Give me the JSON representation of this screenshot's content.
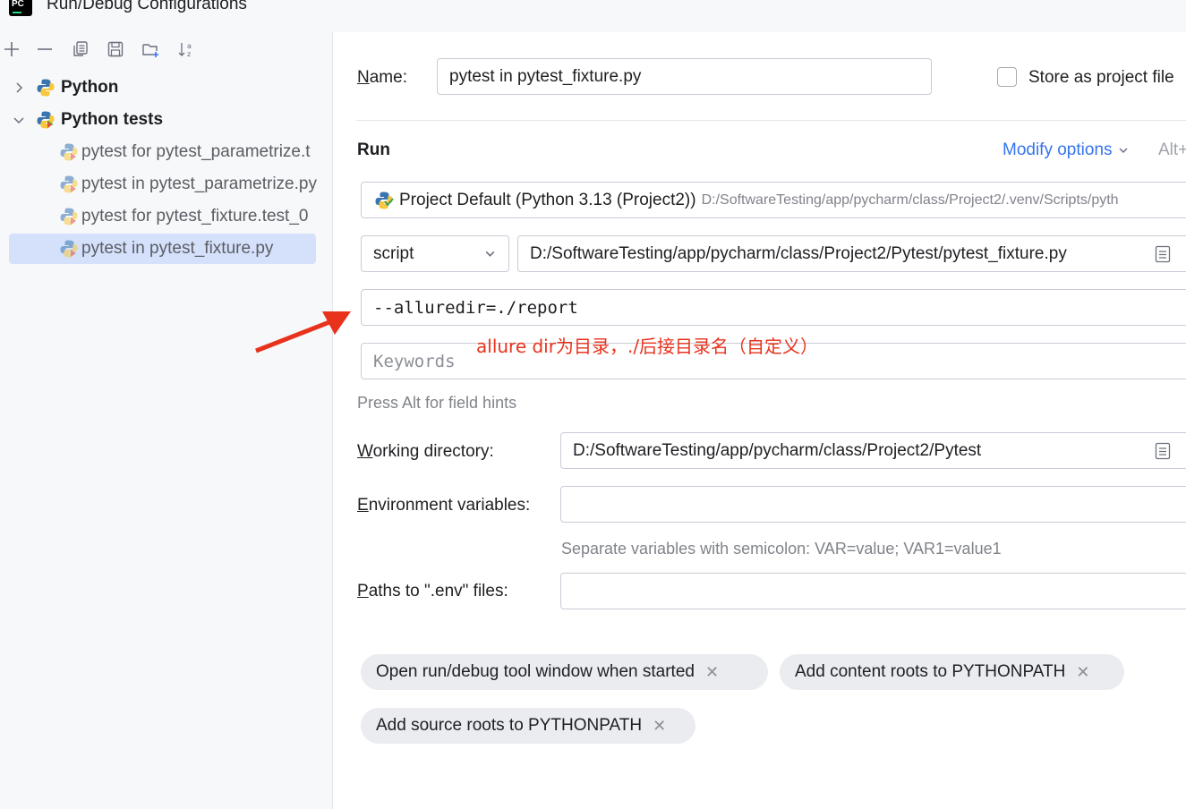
{
  "window": {
    "title": "Run/Debug Configurations",
    "app_icon_text": "PC"
  },
  "toolbar": {
    "icons": [
      "add-icon",
      "remove-icon",
      "copy-icon",
      "save-icon",
      "new-folder-icon",
      "sort-icon"
    ]
  },
  "tree": {
    "groups": [
      {
        "label": "Python",
        "expanded": false
      },
      {
        "label": "Python tests",
        "expanded": true
      }
    ],
    "items": [
      {
        "label": "pytest for pytest_parametrize.t"
      },
      {
        "label": "pytest in pytest_parametrize.py"
      },
      {
        "label": "pytest for pytest_fixture.test_0"
      },
      {
        "label": "pytest in pytest_fixture.py",
        "selected": true
      }
    ]
  },
  "form": {
    "name_label_u": "N",
    "name_label_rest": "ame:",
    "name_value": "pytest in pytest_fixture.py",
    "store_label": "Store as project file",
    "run_section": "Run",
    "modify_options": "Modify options",
    "alt_hint": "Alt+",
    "interpreter_name": "Project Default (Python 3.13 (Project2))",
    "interpreter_path": "D:/SoftwareTesting/app/pycharm/class/Project2/.venv/Scripts/pyth",
    "target_type": "script",
    "script_path": "D:/SoftwareTesting/app/pycharm/class/Project2/Pytest/pytest_fixture.py",
    "additional_args": "--alluredir=./report",
    "keywords_placeholder": "Keywords",
    "field_hints": "Press Alt for field hints",
    "working_dir_label_u": "W",
    "working_dir_label_rest": "orking directory:",
    "working_dir": "D:/SoftwareTesting/app/pycharm/class/Project2/Pytest",
    "env_label_u": "E",
    "env_label_rest": "nvironment variables:",
    "env_value": "",
    "env_hint": "Separate variables with semicolon: VAR=value; VAR1=value1",
    "paths_label_u": "P",
    "paths_label_rest": "aths to \".env\" files:",
    "paths_value": ""
  },
  "chips": [
    {
      "label": "Open run/debug tool window when started"
    },
    {
      "label": "Add content roots to PYTHONPATH"
    },
    {
      "label": "Add source roots to PYTHONPATH"
    }
  ],
  "annotation": {
    "text": "allure dir为目录，./后接目录名（自定义）",
    "color": "#e8321c"
  },
  "colors": {
    "accent": "#3574f0",
    "selection": "#d5e1fb",
    "annotation": "#e8321c"
  }
}
